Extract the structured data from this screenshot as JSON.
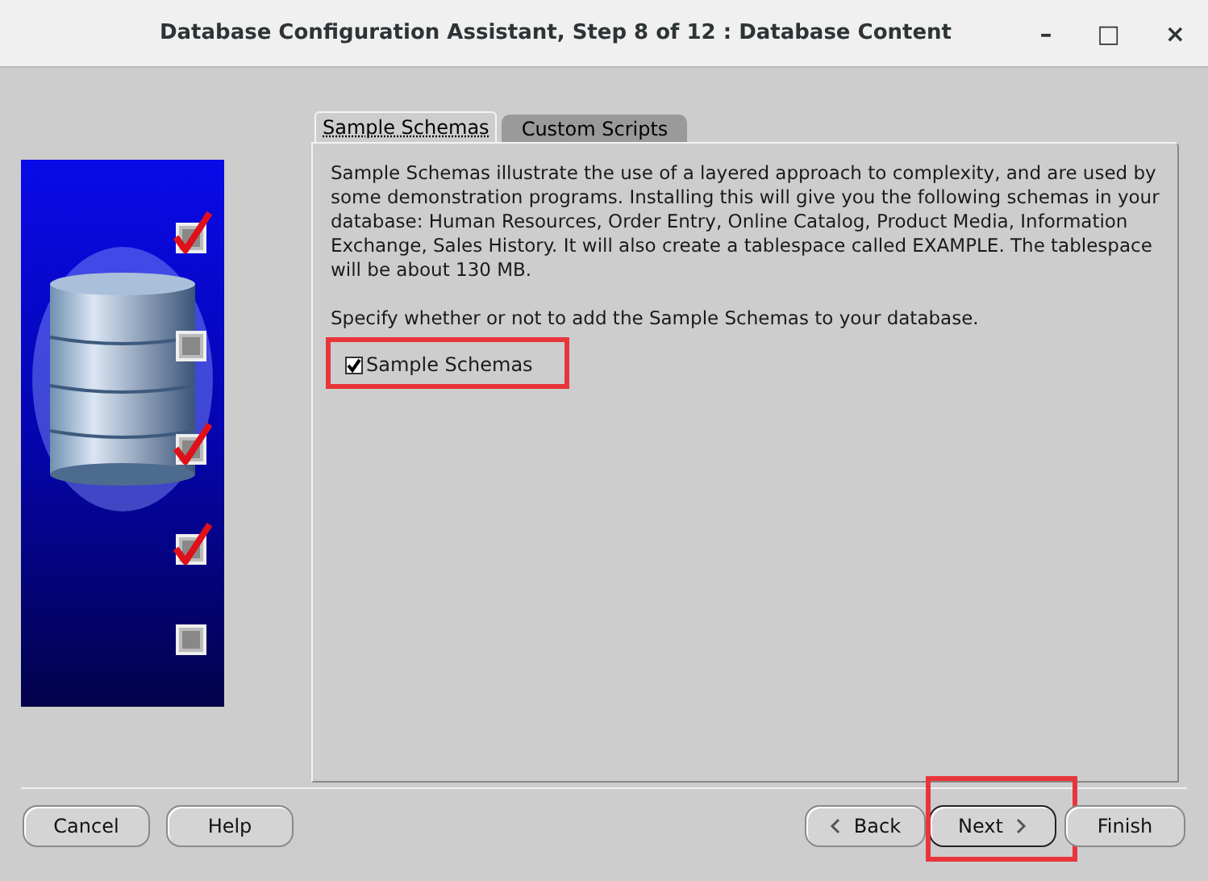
{
  "window": {
    "title": "Database Configuration Assistant, Step 8 of 12 : Database Content",
    "controls": [
      "–",
      "□",
      "×"
    ]
  },
  "banner_steps": [
    {
      "checked": true
    },
    {
      "checked": false
    },
    {
      "checked": true
    },
    {
      "checked": true
    },
    {
      "checked": false
    }
  ],
  "tabs": [
    {
      "label": "Sample Schemas",
      "selected": true
    },
    {
      "label": "Custom Scripts",
      "selected": false
    }
  ],
  "description": "Sample Schemas illustrate the use of a layered approach to complexity, and are used by some demonstration programs. Installing this will give you the following schemas in your database: Human Resources, Order Entry, Online Catalog, Product Media, Information Exchange, Sales History. It will also create a tablespace called EXAMPLE. The tablespace will be about 130 MB.",
  "prompt": "Specify whether or not to add the Sample Schemas to your database.",
  "checkbox": {
    "label": "Sample Schemas",
    "checked": true,
    "highlighted": true
  },
  "buttons_left": [
    {
      "label": "Cancel"
    },
    {
      "label": "Help"
    }
  ],
  "buttons_right": [
    {
      "label": "Back",
      "kind": "back",
      "highlighted": false
    },
    {
      "label": "Next",
      "kind": "next",
      "highlighted": true
    },
    {
      "label": "Finish",
      "kind": "plain",
      "highlighted": false
    }
  ]
}
